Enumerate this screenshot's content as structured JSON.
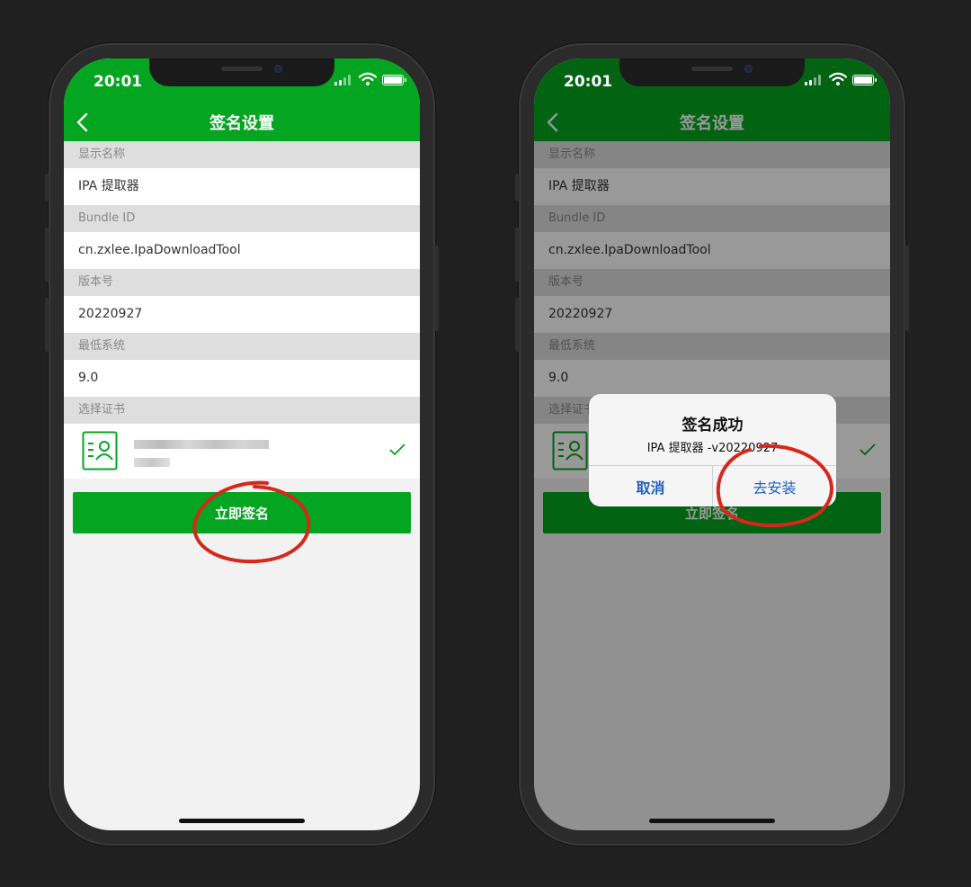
{
  "status": {
    "time": "20:01"
  },
  "nav": {
    "title": "签名设置"
  },
  "sections": [
    {
      "header": "显示名称",
      "value": "IPA 提取器"
    },
    {
      "header": "Bundle ID",
      "value": "cn.zxlee.IpaDownloadTool"
    },
    {
      "header": "版本号",
      "value": "20220927"
    },
    {
      "header": "最低系统",
      "value": "9.0"
    }
  ],
  "cert": {
    "header": "选择证书"
  },
  "sign_button": "立即签名",
  "alert": {
    "title": "签名成功",
    "message": "IPA 提取器 -v20220927",
    "cancel": "取消",
    "confirm": "去安装"
  },
  "colors": {
    "brand_green": "#04a520",
    "annotation_red": "#d4281c",
    "link_blue": "#1f5fbf"
  }
}
